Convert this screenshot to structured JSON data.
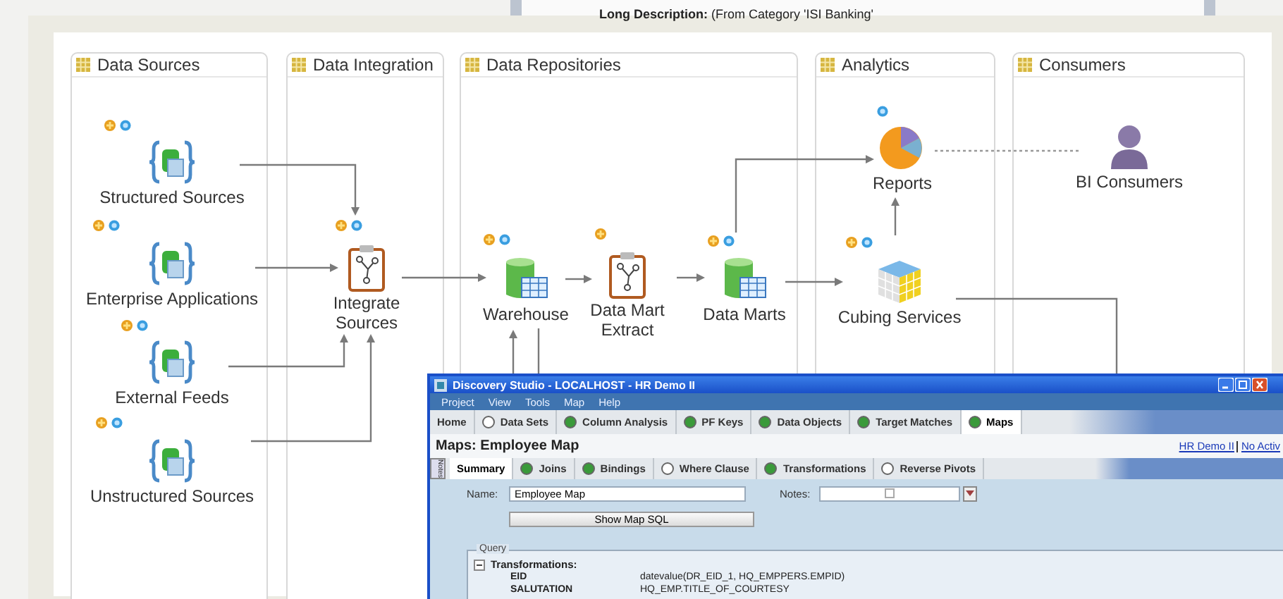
{
  "background_window": {
    "text": "**Long Description:** (From Category 'ISI Banking'"
  },
  "diagram": {
    "lanes": [
      {
        "title": "Data Sources"
      },
      {
        "title": "Data Integration"
      },
      {
        "title": "Data Repositories"
      },
      {
        "title": "Analytics"
      },
      {
        "title": "Consumers"
      }
    ],
    "nodes": [
      {
        "label": "Structured Sources",
        "kind": "source",
        "plus": true,
        "info": true
      },
      {
        "label": "Enterprise Applications",
        "kind": "source",
        "plus": true,
        "info": true
      },
      {
        "label": "External Feeds",
        "kind": "source",
        "plus": true,
        "info": true
      },
      {
        "label": "Unstructured Sources",
        "kind": "source",
        "plus": true,
        "info": true
      },
      {
        "label": "Integrate Sources",
        "kind": "process",
        "plus": true,
        "info": true
      },
      {
        "label": "Warehouse",
        "kind": "warehouse",
        "plus": true,
        "info": true
      },
      {
        "label": "Data Mart Extract",
        "kind": "process",
        "plus": true,
        "info": false
      },
      {
        "label": "Data Marts",
        "kind": "marts",
        "plus": true,
        "info": true
      },
      {
        "label": "Reports",
        "kind": "report",
        "plus": false,
        "info": true
      },
      {
        "label": "Cubing Services",
        "kind": "cube",
        "plus": true,
        "info": true
      },
      {
        "label": "BI Consumers",
        "kind": "person"
      }
    ]
  },
  "window": {
    "title": "Discovery Studio - LOCALHOST - HR Demo II",
    "menu": [
      "Project",
      "View",
      "Tools",
      "Map",
      "Help"
    ],
    "tabs": [
      {
        "label": "Home",
        "kind": "plain",
        "selected": false
      },
      {
        "label": "Data Sets",
        "kind": "radio",
        "done": false,
        "selected": false
      },
      {
        "label": "Column Analysis",
        "kind": "radio",
        "done": true,
        "selected": false
      },
      {
        "label": "PF Keys",
        "kind": "radio",
        "done": true,
        "selected": false
      },
      {
        "label": "Data Objects",
        "kind": "radio",
        "done": true,
        "selected": false
      },
      {
        "label": "Target Matches",
        "kind": "radio",
        "done": true,
        "selected": false
      },
      {
        "label": "Maps",
        "kind": "radio",
        "done": true,
        "selected": true
      }
    ],
    "heading": "Maps: Employee Map",
    "links": [
      "HR Demo II",
      "No Activ"
    ],
    "side_tab": "Notes",
    "subtabs": [
      {
        "label": "Summary",
        "kind": "plain",
        "selected": true
      },
      {
        "label": "Joins",
        "kind": "radio",
        "done": true,
        "selected": false
      },
      {
        "label": "Bindings",
        "kind": "radio",
        "done": true,
        "selected": false
      },
      {
        "label": "Where Clause",
        "kind": "radio",
        "done": false,
        "selected": false
      },
      {
        "label": "Transformations",
        "kind": "radio",
        "done": true,
        "selected": false
      },
      {
        "label": "Reverse Pivots",
        "kind": "radio",
        "done": false,
        "selected": false
      }
    ],
    "form": {
      "name_label": "Name:",
      "name_value": "Employee Map",
      "notes_label": "Notes:",
      "button": "Show Map SQL"
    },
    "query": {
      "legend": "Query",
      "section": "Transformations:",
      "expanded": true,
      "rows": [
        {
          "field": "EID",
          "expression": "datevalue(DR_EID_1, HQ_EMPPERS.EMPID)"
        },
        {
          "field": "SALUTATION",
          "expression": "HQ_EMP.TITLE_OF_COURTESY"
        }
      ]
    }
  }
}
